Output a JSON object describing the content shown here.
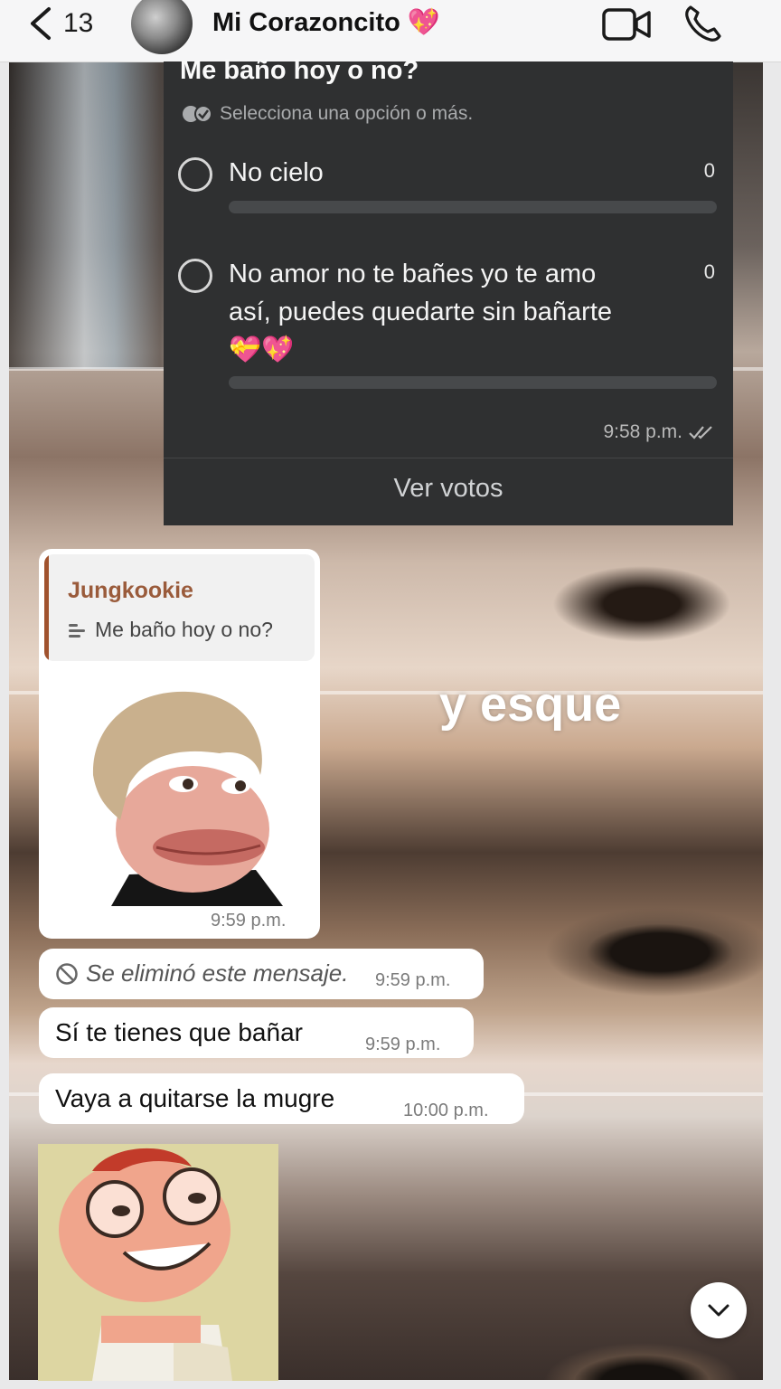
{
  "header": {
    "back_count": "13",
    "chat_title": "Mi Corazoncito 💖"
  },
  "poll": {
    "question": "Me baño  hoy o no?",
    "hint": "Selecciona una opción o más.",
    "options": [
      {
        "label": "No cielo",
        "count": "0"
      },
      {
        "label": "No amor no te bañes yo te amo así, puedes quedarte sin bañarte 💝💖",
        "count": "0"
      }
    ],
    "time": "9:58 p.m.",
    "view_votes": "Ver votos"
  },
  "reply": {
    "quoted_name": "Jungkookie",
    "quoted_text": "Me baño  hoy o no?",
    "time": "9:59 p.m."
  },
  "messages": [
    {
      "text": "Se eliminó este mensaje.",
      "time": "9:59 p.m.",
      "deleted": true
    },
    {
      "text": "Sí te tienes que bañar",
      "time": "9:59 p.m."
    },
    {
      "text": "Vaya a quitarse la mugre",
      "time": "10:00 p.m."
    }
  ],
  "overlay_caption": "y esque",
  "colors": {
    "poll_bg": "#2f3031",
    "bubble_bg": "#ffffff",
    "quote_accent": "#a0522d"
  }
}
